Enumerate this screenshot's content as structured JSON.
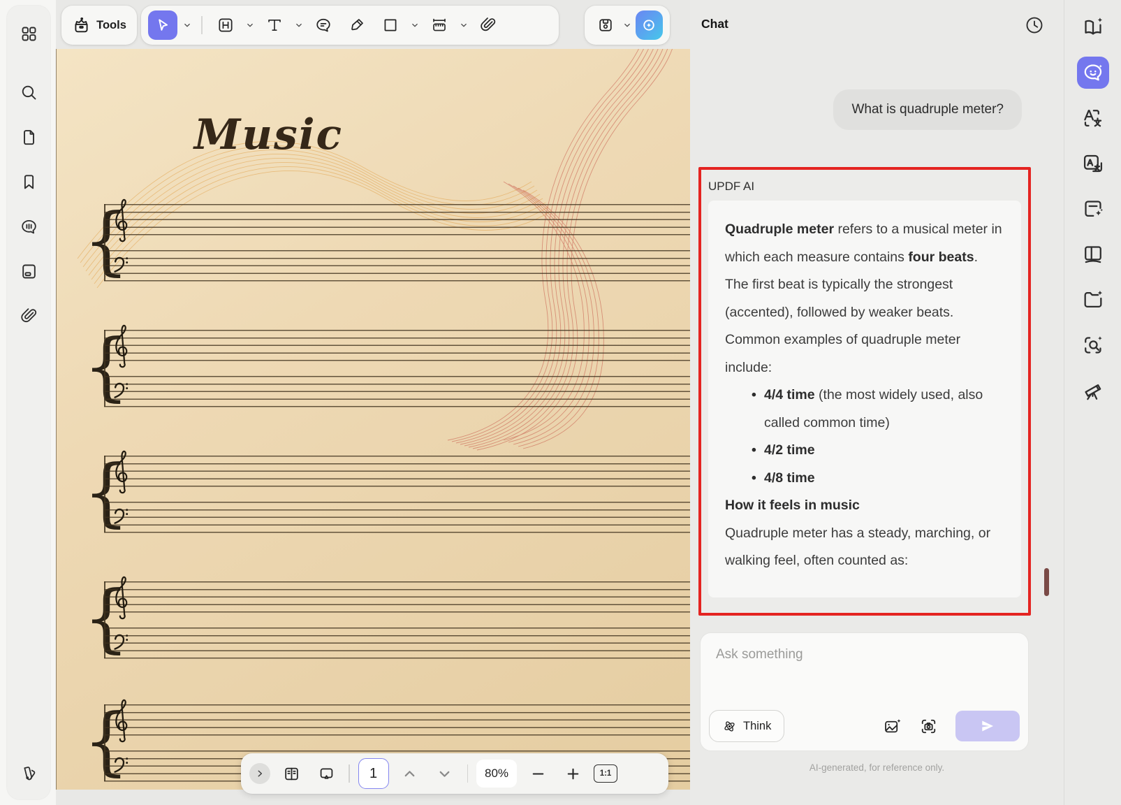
{
  "left_sidebar": {
    "icons": [
      "apps-grid-icon",
      "search-icon",
      "thumbnails-icon",
      "bookmark-icon",
      "comments-icon",
      "slideshow-icon",
      "attachments-icon",
      "swatches-icon"
    ]
  },
  "toolbar": {
    "tools_label": "Tools",
    "selected_tool": "select-cursor",
    "icons": [
      "toolbox-icon",
      "select-cursor-icon",
      "heading-icon",
      "text-icon",
      "comment-icon",
      "highlighter-icon",
      "shape-square-icon",
      "measure-icon",
      "attach-icon",
      "save-icon",
      "updf-ai-icon"
    ]
  },
  "document": {
    "title": "Music",
    "staff_systems": 5
  },
  "bottom_bar": {
    "page_number": "1",
    "zoom_level": "80%",
    "fit_label": "1:1",
    "icons": [
      "expand-chevron-icon",
      "two-page-view-icon",
      "presentation-icon",
      "page-up-icon",
      "page-down-icon",
      "zoom-out-icon",
      "zoom-in-icon",
      "actual-size-icon"
    ]
  },
  "chat": {
    "title": "Chat",
    "history_icon": "clock-icon",
    "user_message": "What is quadruple meter?",
    "ai_name": "UPDF AI",
    "response": {
      "p1_bold_1": "Quadruple meter",
      "p1_text_1": " refers to a musical meter in which each measure contains ",
      "p1_bold_2": "four beats",
      "p1_text_2": ". The first beat is typically the strongest (accented), followed by weaker beats.",
      "p2": "Common examples of quadruple meter include:",
      "bullets": [
        {
          "bold": "4/4 time",
          "text": " (the most widely used, also called common time)"
        },
        {
          "bold": "4/2 time",
          "text": ""
        },
        {
          "bold": "4/8 time",
          "text": ""
        }
      ],
      "heading": "How it feels in music",
      "p3": "Quadruple meter has a steady, marching, or walking feel, often counted as:"
    },
    "input": {
      "placeholder": "Ask something",
      "think_label": "Think",
      "icons": [
        "atom-icon",
        "add-image-icon",
        "screenshot-icon",
        "send-icon"
      ]
    },
    "disclaimer": "AI-generated, for reference only."
  },
  "right_sidebar": {
    "icons": [
      "ai-read-book-icon",
      "ai-chat-icon",
      "translate-text-icon",
      "translate-doc-icon",
      "ai-note-icon",
      "reading-mode-icon",
      "ai-folder-icon",
      "ai-search-icon",
      "telescope-icon"
    ],
    "selected": "ai-chat-icon"
  },
  "colors": {
    "accent_purple": "#7477ee",
    "annotation_red": "#e42421",
    "ai_button_gradient": [
      "#6a86f2",
      "#45c8ea"
    ],
    "send_button": "#c9c6f3",
    "parchment": "#eed9b4"
  }
}
